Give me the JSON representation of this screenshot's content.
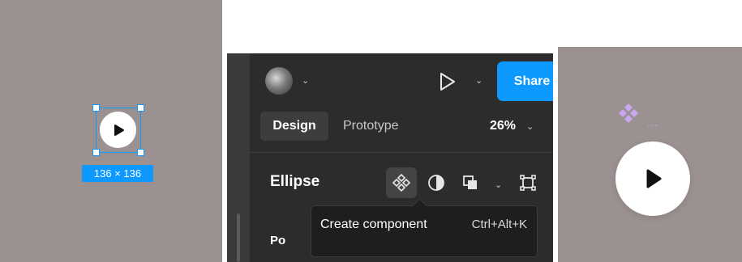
{
  "left_canvas": {
    "size_label": "136 × 136",
    "icons": {
      "play": "play-icon"
    }
  },
  "panel": {
    "tabs": [
      {
        "label": "Design",
        "active": true
      },
      {
        "label": "Prototype",
        "active": false
      }
    ],
    "zoom": "26%",
    "share_label": "Share",
    "layer_name": "Ellipse",
    "section_partial": "Po",
    "tooltip": {
      "text": "Create component",
      "shortcut": "Ctrl+Alt+K"
    },
    "icons": {
      "avatar": "avatar",
      "present": "play-outline-icon",
      "component": "component-icon",
      "mask": "mask-icon",
      "boolean": "boolean-icon",
      "frame": "frame-selection-icon"
    },
    "colors": {
      "accent": "#0d99ff",
      "panel_bg": "#2c2c2c"
    }
  },
  "right_canvas": {
    "component_label": "...",
    "icons": {
      "component": "component-icon",
      "play": "play-icon"
    },
    "colors": {
      "component": "#c9a6f0",
      "canvas": "#9b9190"
    }
  }
}
